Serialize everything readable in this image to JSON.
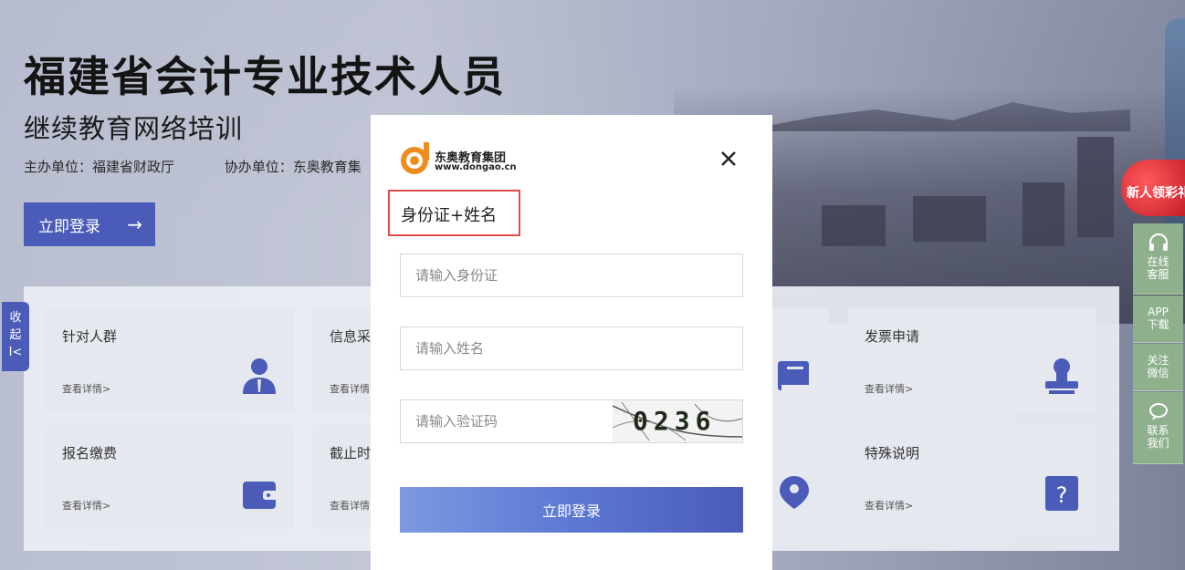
{
  "hero": {
    "title": "福建省会计专业技术人员",
    "subtitle": "继续教育网络培训",
    "host": "主办单位：福建省财政厅",
    "cohost": "协办单位：东奥教育集",
    "login_button": "立即登录"
  },
  "collapse_tab": {
    "label_1": "收",
    "label_2": "起",
    "label_3": "I<"
  },
  "cards": [
    {
      "title": "针对人群",
      "more": "查看详情>",
      "icon": "people-icon"
    },
    {
      "title": "信息采",
      "more": "查看详情",
      "icon": "info-icon"
    },
    {
      "title": "发票申请",
      "more": "查看详情>",
      "icon": "stamp-icon"
    },
    {
      "title": "报名缴费",
      "more": "查看详情>",
      "icon": "wallet-icon"
    },
    {
      "title": "截止时",
      "more": "查看详情",
      "icon": "clock-icon"
    },
    {
      "title": "特殊说明",
      "more": "查看详情>",
      "icon": "question-icon"
    }
  ],
  "side_bar": {
    "promo": "新人领彩礼",
    "items": [
      {
        "line1": "在线",
        "line2": "客服",
        "icon": "headset-icon"
      },
      {
        "line1": "APP",
        "line2": "下载",
        "icon": ""
      },
      {
        "line1": "关注",
        "line2": "微信",
        "icon": ""
      },
      {
        "line1": "联系",
        "line2": "我们",
        "icon": "chat-icon"
      }
    ]
  },
  "modal": {
    "logo_brand": "东奥教育集团",
    "logo_url": "www.dongao.cn",
    "tab_label": "身份证+姓名",
    "id_placeholder": "请输入身份证",
    "name_placeholder": "请输入姓名",
    "captcha_placeholder": "请输入验证码",
    "captcha_text": "0236",
    "submit_label": "立即登录"
  },
  "colors": {
    "accent": "#4a5bb8",
    "highlight_border": "#e24b4b",
    "side_bar": "#8fb08d"
  }
}
